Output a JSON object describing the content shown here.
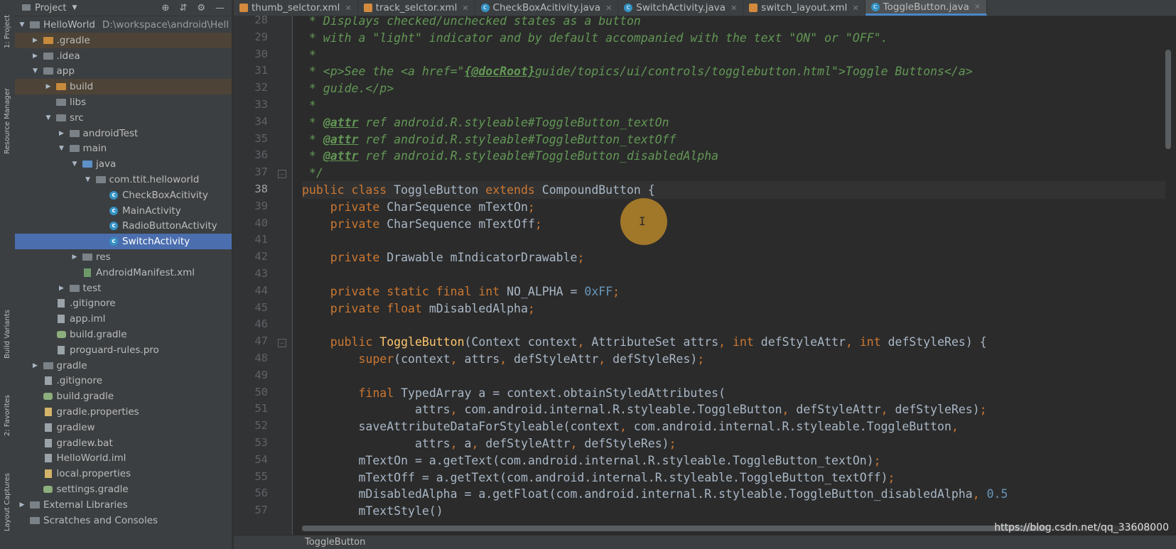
{
  "tool_tabs": {
    "project": "1: Project",
    "resource_manager": "Resource Manager",
    "build_variants": "Build Variants",
    "favorites": "2: Favorites",
    "layout_captures": "Layout Captures"
  },
  "project_panel": {
    "title": "Project",
    "tree": [
      {
        "label": "HelloWorld",
        "suffix": "D:\\workspace\\android\\Hell",
        "indent": 0,
        "arrow": "▼",
        "icon": "folder-grey"
      },
      {
        "label": ".gradle",
        "indent": 1,
        "arrow": "▶",
        "icon": "folder-orange",
        "hl": "orange"
      },
      {
        "label": ".idea",
        "indent": 1,
        "arrow": "▶",
        "icon": "folder-grey"
      },
      {
        "label": "app",
        "indent": 1,
        "arrow": "▼",
        "icon": "folder-grey"
      },
      {
        "label": "build",
        "indent": 2,
        "arrow": "▶",
        "icon": "folder-orange",
        "hl": "orange"
      },
      {
        "label": "libs",
        "indent": 2,
        "arrow": "",
        "icon": "folder-grey"
      },
      {
        "label": "src",
        "indent": 2,
        "arrow": "▼",
        "icon": "folder-grey"
      },
      {
        "label": "androidTest",
        "indent": 3,
        "arrow": "▶",
        "icon": "folder-grey"
      },
      {
        "label": "main",
        "indent": 3,
        "arrow": "▼",
        "icon": "folder-grey"
      },
      {
        "label": "java",
        "indent": 4,
        "arrow": "▼",
        "icon": "folder-blue"
      },
      {
        "label": "com.ttit.helloworld",
        "indent": 5,
        "arrow": "▼",
        "icon": "folder-grey"
      },
      {
        "label": "CheckBoxAcitivity",
        "indent": 6,
        "arrow": "",
        "icon": "class"
      },
      {
        "label": "MainActivity",
        "indent": 6,
        "arrow": "",
        "icon": "class"
      },
      {
        "label": "RadioButtonActivity",
        "indent": 6,
        "arrow": "",
        "icon": "class"
      },
      {
        "label": "SwitchActivity",
        "indent": 6,
        "arrow": "",
        "icon": "class",
        "hl": "selected"
      },
      {
        "label": "res",
        "indent": 4,
        "arrow": "▶",
        "icon": "folder-grey"
      },
      {
        "label": "AndroidManifest.xml",
        "indent": 4,
        "arrow": "",
        "icon": "file-green"
      },
      {
        "label": "test",
        "indent": 3,
        "arrow": "▶",
        "icon": "folder-grey"
      },
      {
        "label": ".gitignore",
        "indent": 2,
        "arrow": "",
        "icon": "file"
      },
      {
        "label": "app.iml",
        "indent": 2,
        "arrow": "",
        "icon": "file"
      },
      {
        "label": "build.gradle",
        "indent": 2,
        "arrow": "",
        "icon": "file-gradle"
      },
      {
        "label": "proguard-rules.pro",
        "indent": 2,
        "arrow": "",
        "icon": "file"
      },
      {
        "label": "gradle",
        "indent": 1,
        "arrow": "▶",
        "icon": "folder-grey"
      },
      {
        "label": ".gitignore",
        "indent": 1,
        "arrow": "",
        "icon": "file"
      },
      {
        "label": "build.gradle",
        "indent": 1,
        "arrow": "",
        "icon": "file-gradle"
      },
      {
        "label": "gradle.properties",
        "indent": 1,
        "arrow": "",
        "icon": "file-props"
      },
      {
        "label": "gradlew",
        "indent": 1,
        "arrow": "",
        "icon": "file"
      },
      {
        "label": "gradlew.bat",
        "indent": 1,
        "arrow": "",
        "icon": "file"
      },
      {
        "label": "HelloWorld.iml",
        "indent": 1,
        "arrow": "",
        "icon": "file"
      },
      {
        "label": "local.properties",
        "indent": 1,
        "arrow": "",
        "icon": "file-props"
      },
      {
        "label": "settings.gradle",
        "indent": 1,
        "arrow": "",
        "icon": "file-gradle"
      },
      {
        "label": "External Libraries",
        "indent": 0,
        "arrow": "▶",
        "icon": "folder-grey"
      },
      {
        "label": "Scratches and Consoles",
        "indent": 0,
        "arrow": "",
        "icon": "folder-grey"
      }
    ]
  },
  "tabs": [
    {
      "label": "thumb_selctor.xml",
      "type": "xml"
    },
    {
      "label": "track_selctor.xml",
      "type": "xml"
    },
    {
      "label": "CheckBoxAcitivity.java",
      "type": "java"
    },
    {
      "label": "SwitchActivity.java",
      "type": "java"
    },
    {
      "label": "switch_layout.xml",
      "type": "xml"
    },
    {
      "label": "ToggleButton.java",
      "type": "java",
      "active": true
    }
  ],
  "editor": {
    "current_line": 38,
    "lines": [
      {
        "n": 28,
        "html": "<span class=\"cm\"> * Displays checked/unchecked states as a button</span>"
      },
      {
        "n": 29,
        "html": "<span class=\"cm\"> * with a \"light\" indicator and by default accompanied with the text \"ON\" or \"OFF\".</span>"
      },
      {
        "n": 30,
        "html": "<span class=\"cm\"> *</span>"
      },
      {
        "n": 31,
        "html": "<span class=\"cm\"> * &lt;p&gt;See the &lt;a href=\"</span><span class=\"cm-b\">{@docRoot}</span><span class=\"cm\">guide/topics/ui/controls/togglebutton.html\"&gt;Toggle Buttons&lt;/a&gt;</span>"
      },
      {
        "n": 32,
        "html": "<span class=\"cm\"> * guide.&lt;/p&gt;</span>"
      },
      {
        "n": 33,
        "html": "<span class=\"cm\"> *</span>"
      },
      {
        "n": 34,
        "html": "<span class=\"cm\"> * </span><span class=\"cm-b\">@attr</span><span class=\"cm\"> ref android.R.styleable#ToggleButton_textOn</span>"
      },
      {
        "n": 35,
        "html": "<span class=\"cm\"> * </span><span class=\"cm-b\">@attr</span><span class=\"cm\"> ref android.R.styleable#ToggleButton_textOff</span>"
      },
      {
        "n": 36,
        "html": "<span class=\"cm\"> * </span><span class=\"cm-b\">@attr</span><span class=\"cm\"> ref android.R.styleable#ToggleButton_disabledAlpha</span>"
      },
      {
        "n": 37,
        "html": "<span class=\"cm\"> */</span>"
      },
      {
        "n": 38,
        "html": "<span class=\"kw\">public class</span> ToggleButton <span class=\"kw\">extends</span> CompoundButton {"
      },
      {
        "n": 39,
        "html": "    <span class=\"kw\">private</span> CharSequence mTextOn<span class=\"kw\">;</span>"
      },
      {
        "n": 40,
        "html": "    <span class=\"kw\">private</span> CharSequence mTextOff<span class=\"kw\">;</span>"
      },
      {
        "n": 41,
        "html": ""
      },
      {
        "n": 42,
        "html": "    <span class=\"kw\">private</span> Drawable mIndicatorDrawable<span class=\"kw\">;</span>"
      },
      {
        "n": 43,
        "html": ""
      },
      {
        "n": 44,
        "html": "    <span class=\"kw\">private static final int</span> NO_ALPHA = <span class=\"num\">0xFF</span><span class=\"kw\">;</span>"
      },
      {
        "n": 45,
        "html": "    <span class=\"kw\">private float</span> mDisabledAlpha<span class=\"kw\">;</span>"
      },
      {
        "n": 46,
        "html": ""
      },
      {
        "n": 47,
        "html": "    <span class=\"kw\">public</span> <span class=\"fn\">ToggleButton</span>(Context context<span class=\"kw\">,</span> AttributeSet attrs<span class=\"kw\">, int</span> defStyleAttr<span class=\"kw\">, int</span> defStyleRes) {"
      },
      {
        "n": 48,
        "html": "        <span class=\"kw\">super</span>(context<span class=\"kw\">,</span> attrs<span class=\"kw\">,</span> defStyleAttr<span class=\"kw\">,</span> defStyleRes)<span class=\"kw\">;</span>"
      },
      {
        "n": 49,
        "html": ""
      },
      {
        "n": 50,
        "html": "        <span class=\"kw\">final</span> TypedArray a = context.obtainStyledAttributes("
      },
      {
        "n": 51,
        "html": "                attrs<span class=\"kw\">,</span> com.android.internal.R.styleable.ToggleButton<span class=\"kw\">,</span> defStyleAttr<span class=\"kw\">,</span> defStyleRes)<span class=\"kw\">;</span>"
      },
      {
        "n": 52,
        "html": "        saveAttributeDataForStyleable(context<span class=\"kw\">,</span> com.android.internal.R.styleable.ToggleButton<span class=\"kw\">,</span>"
      },
      {
        "n": 53,
        "html": "                attrs<span class=\"kw\">,</span> a<span class=\"kw\">,</span> defStyleAttr<span class=\"kw\">,</span> defStyleRes)<span class=\"kw\">;</span>"
      },
      {
        "n": 54,
        "html": "        mTextOn = a.getText(com.android.internal.R.styleable.ToggleButton_textOn)<span class=\"kw\">;</span>"
      },
      {
        "n": 55,
        "html": "        mTextOff = a.getText(com.android.internal.R.styleable.ToggleButton_textOff)<span class=\"kw\">;</span>"
      },
      {
        "n": 56,
        "html": "        mDisabledAlpha = a.getFloat(com.android.internal.R.styleable.ToggleButton_disabledAlpha<span class=\"kw\">,</span> <span class=\"num\">0.5</span>"
      },
      {
        "n": 57,
        "html": "        mTextStyle()"
      }
    ]
  },
  "breadcrumb": "ToggleButton",
  "watermark": "https://blog.csdn.net/qq_33608000"
}
